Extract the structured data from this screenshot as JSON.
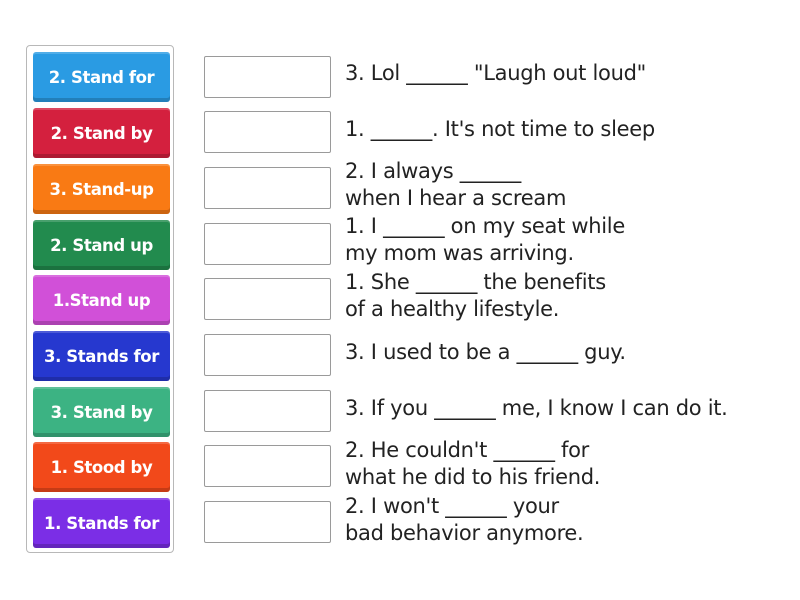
{
  "tiles": [
    {
      "label": "2. Stand for",
      "color": "#2a9be3"
    },
    {
      "label": "2. Stand by",
      "color": "#d4203e"
    },
    {
      "label": "3. Stand-up",
      "color": "#f97a14"
    },
    {
      "label": "2. Stand up",
      "color": "#228b4e"
    },
    {
      "label": "1.Stand up",
      "color": "#d150d8"
    },
    {
      "label": "3. Stands for",
      "color": "#2638cf"
    },
    {
      "label": "3. Stand by",
      "color": "#3cb383"
    },
    {
      "label": "1. Stood by",
      "color": "#f2491a"
    },
    {
      "label": "1. Stands for",
      "color": "#7b2ee6"
    }
  ],
  "targets": [
    {
      "value": "",
      "lines": [
        "3. Lol ______ \"Laugh out loud\""
      ]
    },
    {
      "value": "",
      "lines": [
        "1. ______. It's not time to sleep"
      ]
    },
    {
      "value": "",
      "lines": [
        "2. I always ______",
        "when I hear a scream"
      ]
    },
    {
      "value": "",
      "lines": [
        "1. I ______ on my seat while",
        "my mom was arriving."
      ]
    },
    {
      "value": "",
      "lines": [
        "1. She ______ the benefits",
        "of a healthy lifestyle."
      ]
    },
    {
      "value": "",
      "lines": [
        "3. I used to be a ______ guy."
      ]
    },
    {
      "value": "",
      "lines": [
        "3. If you ______ me, I know I can do it."
      ]
    },
    {
      "value": "",
      "lines": [
        "2. He couldn't ______ for",
        "what he did to his friend."
      ]
    },
    {
      "value": "",
      "lines": [
        "2. I won't ______ your",
        "bad behavior anymore."
      ]
    }
  ]
}
